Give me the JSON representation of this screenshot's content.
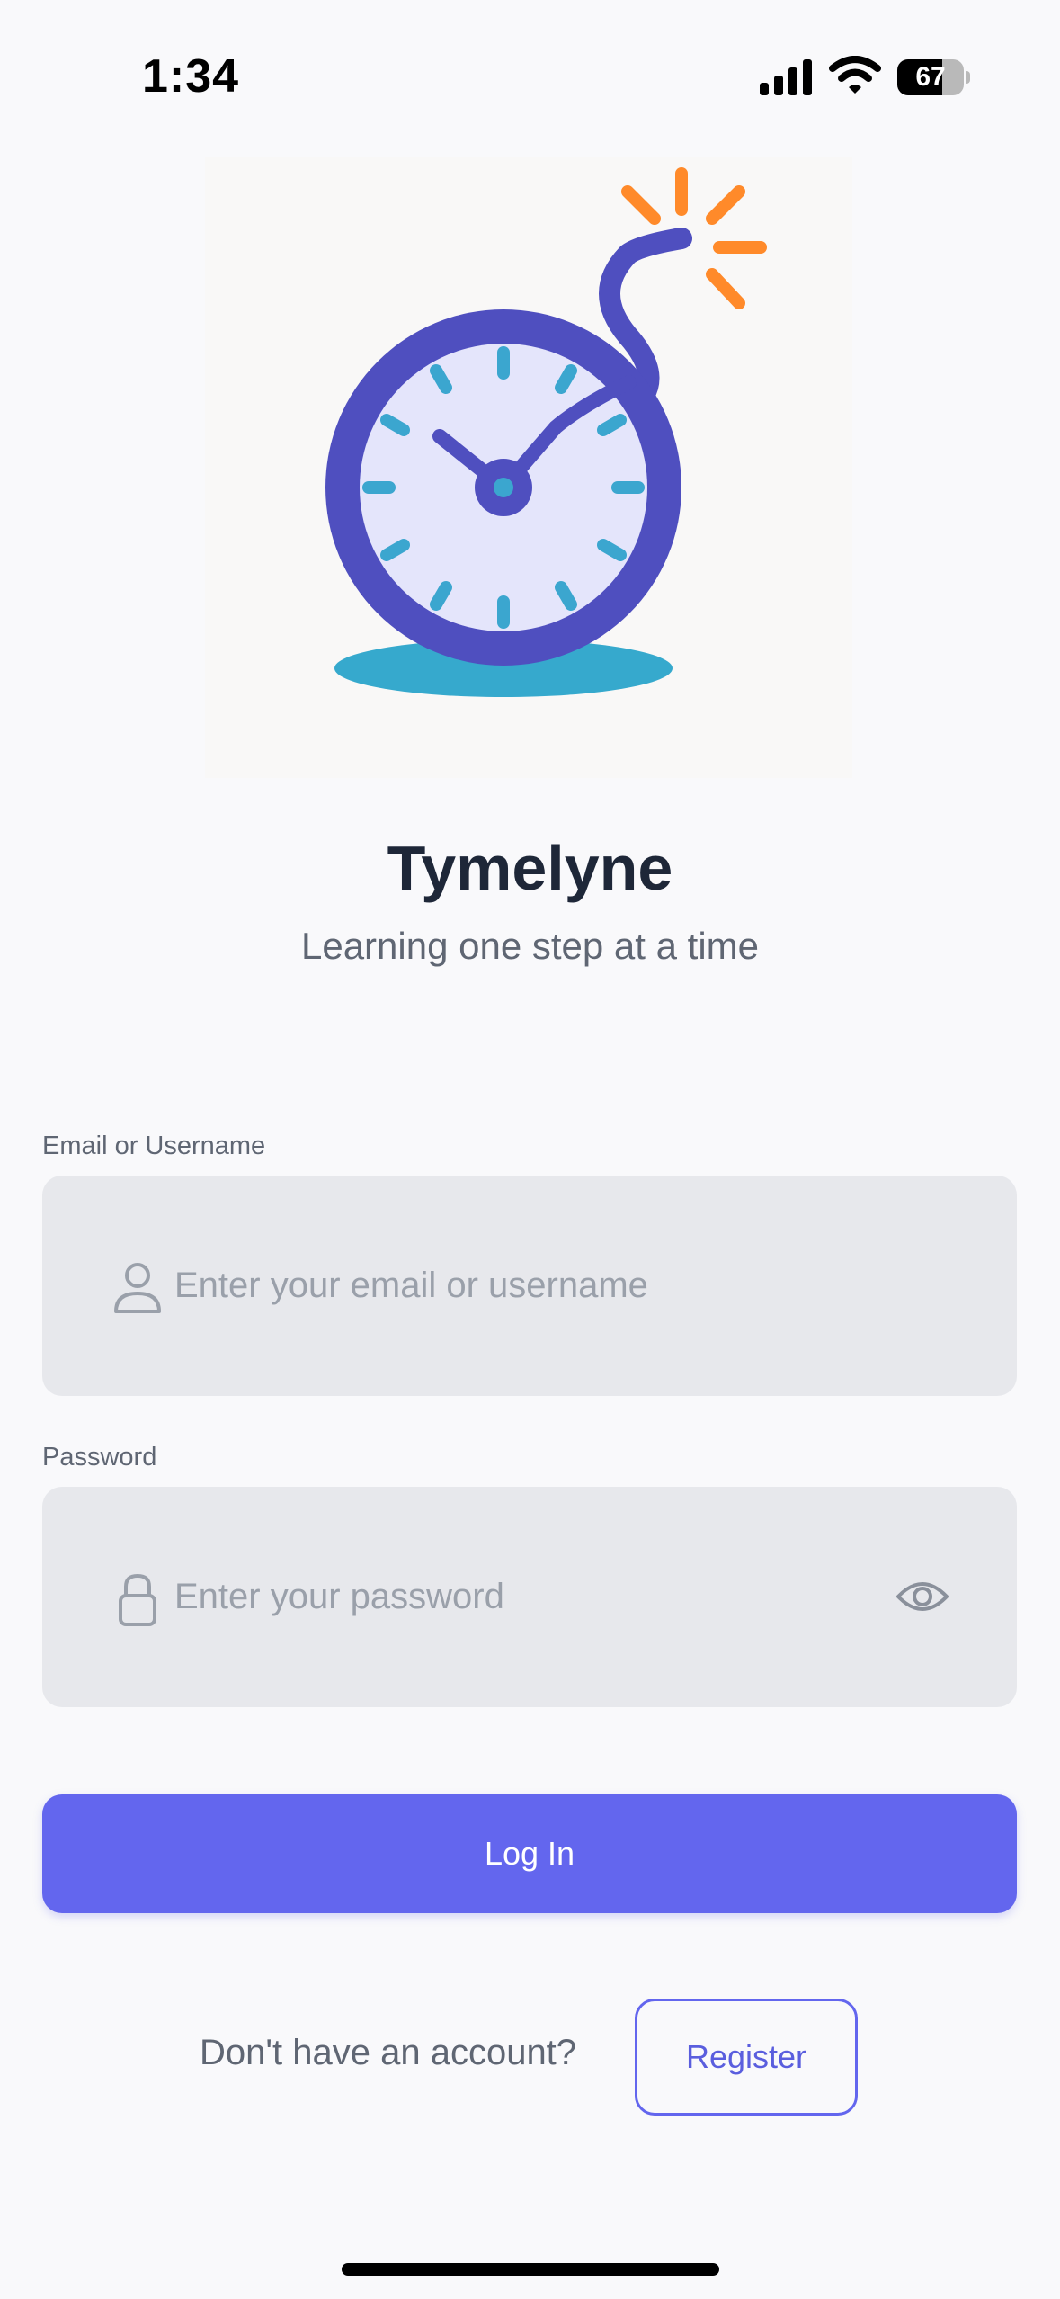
{
  "status_bar": {
    "time": "1:34",
    "battery_level": "67",
    "battery_fraction": 0.67,
    "icons": [
      "signal-icon",
      "wifi-icon",
      "battery-icon"
    ]
  },
  "logo": {
    "icon": "bomb-clock-logo",
    "colors": {
      "ring": "#4f4fbf",
      "face": "#e4e5fb",
      "ticks": "#3ba6cf",
      "spark": "#ff8a2a",
      "shadow": "#36a9cd"
    }
  },
  "app": {
    "title": "Tymelyne",
    "subtitle": "Learning one step at a time"
  },
  "form": {
    "email": {
      "label": "Email or Username",
      "placeholder": "Enter your email or username",
      "value": "",
      "icon": "user-icon"
    },
    "password": {
      "label": "Password",
      "placeholder": "Enter your password",
      "value": "",
      "icon": "lock-icon",
      "toggle_icon": "eye-icon"
    },
    "login_label": "Log In"
  },
  "register": {
    "prompt": "Don't have an account?",
    "button_label": "Register"
  },
  "colors": {
    "accent": "#6366ee",
    "background": "#f9f9fb",
    "field_bg": "#e7e8ec",
    "title": "#1e2738",
    "muted_text": "#5f6673"
  }
}
